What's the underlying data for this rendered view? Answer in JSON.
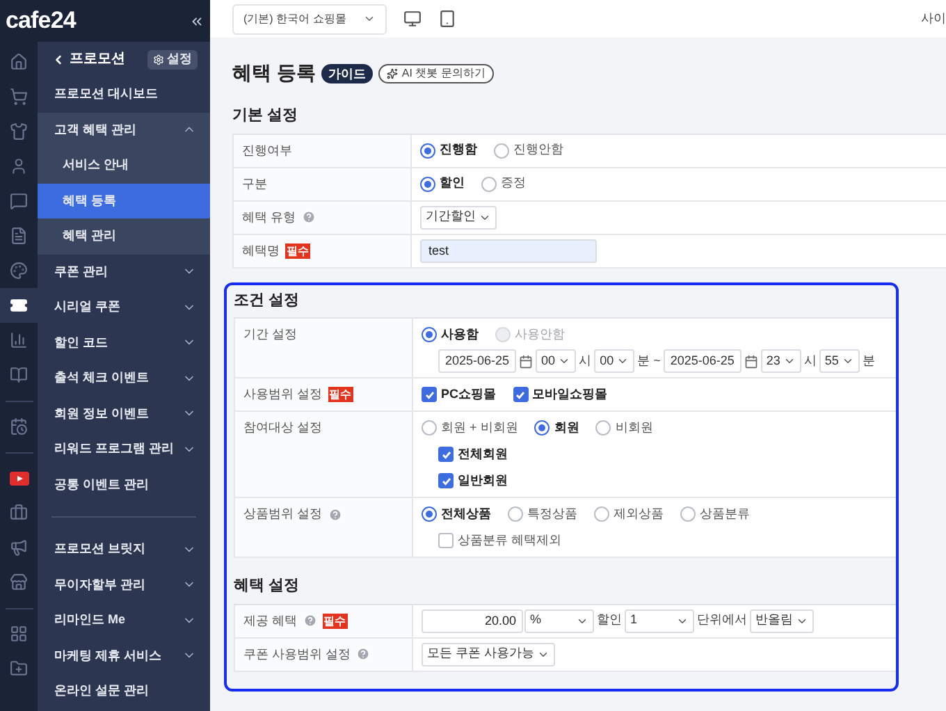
{
  "sidebar": {
    "logo": "cafe24",
    "rail": [
      {
        "kind": "home",
        "selected": false
      },
      {
        "kind": "cart",
        "selected": false
      },
      {
        "kind": "shirt",
        "selected": false
      },
      {
        "kind": "user",
        "selected": false
      },
      {
        "kind": "chat",
        "selected": false
      },
      {
        "kind": "document",
        "selected": false
      },
      {
        "kind": "palette",
        "selected": false
      },
      {
        "kind": "ticket",
        "selected": true
      },
      {
        "kind": "chart",
        "selected": false
      },
      {
        "kind": "book",
        "selected": false
      },
      {
        "kind": "divider"
      },
      {
        "kind": "calendar",
        "selected": false
      },
      {
        "kind": "divider"
      },
      {
        "kind": "video",
        "selected": false
      },
      {
        "kind": "bag",
        "selected": false
      },
      {
        "kind": "megaphone",
        "selected": false
      },
      {
        "kind": "store",
        "selected": false
      },
      {
        "kind": "divider"
      },
      {
        "kind": "apps",
        "selected": false
      },
      {
        "kind": "folder",
        "selected": false
      }
    ],
    "menu_title": "프로모션",
    "settings": "설정",
    "menu_sections": [
      [
        {
          "kind": "link",
          "label": "프로모션 대시보드",
          "selected": false
        },
        {
          "kind": "group",
          "label": "고객 혜택 관리",
          "expanded": true,
          "selected": false,
          "children": [
            {
              "label": "서비스 안내",
              "selected": false
            },
            {
              "label": "혜택 등록",
              "selected": true
            },
            {
              "label": "혜택 관리",
              "selected": false
            }
          ]
        },
        {
          "kind": "group",
          "label": "쿠폰 관리",
          "expanded": false,
          "selected": false
        },
        {
          "kind": "group",
          "label": "시리얼 쿠폰",
          "expanded": false,
          "selected": false
        },
        {
          "kind": "group",
          "label": "할인 코드",
          "expanded": false,
          "selected": false
        },
        {
          "kind": "group",
          "label": "출석 체크 이벤트",
          "expanded": false,
          "selected": false
        },
        {
          "kind": "group",
          "label": "회원 정보 이벤트",
          "expanded": false,
          "selected": false
        },
        {
          "kind": "group",
          "label": "리워드 프로그램 관리",
          "expanded": false,
          "selected": false
        },
        {
          "kind": "link",
          "label": "공통 이벤트 관리",
          "selected": false
        }
      ],
      [
        {
          "kind": "group",
          "label": "프로모션 브릿지",
          "expanded": false,
          "selected": false
        },
        {
          "kind": "group",
          "label": "무이자할부 관리",
          "expanded": false,
          "selected": false
        },
        {
          "kind": "group",
          "label": "리마인드 Me",
          "expanded": false,
          "selected": false
        },
        {
          "kind": "group",
          "label": "마케팅 제휴 서비스",
          "expanded": false,
          "selected": false
        },
        {
          "kind": "link",
          "label": "온라인 설문 관리",
          "selected": false
        }
      ]
    ]
  },
  "topbar": {
    "shop_select": "(기본) 한국어 쇼핑몰",
    "right_text": "사이"
  },
  "page": {
    "title": "혜택 등록",
    "guide": "가이드",
    "ai_button": "AI 챗봇 문의하기"
  },
  "sections": [
    {
      "title": "기본 설정",
      "highlighted": false,
      "rows": [
        {
          "label": "진행여부",
          "help": false,
          "lines": [
            [
              {
                "kind": "radio",
                "label": "진행함",
                "selected": true,
                "disabled": false
              },
              {
                "kind": "radio",
                "label": "진행안함",
                "selected": false,
                "disabled": false
              }
            ]
          ]
        },
        {
          "label": "구분",
          "help": false,
          "lines": [
            [
              {
                "kind": "radio",
                "label": "할인",
                "selected": true,
                "disabled": false
              },
              {
                "kind": "radio",
                "label": "증정",
                "selected": false,
                "disabled": false
              }
            ]
          ]
        },
        {
          "label": "혜택 유형",
          "help": true,
          "lines": [
            [
              {
                "kind": "select",
                "value": "기간할인"
              }
            ]
          ]
        },
        {
          "label": "혜택명",
          "help": false,
          "required": "필수",
          "lines": [
            [
              {
                "kind": "input",
                "value": "test"
              }
            ]
          ]
        }
      ]
    },
    {
      "title": "조건 설정",
      "highlighted": true,
      "rows": [
        {
          "label": "기간 설정",
          "help": false,
          "lines": [
            [
              {
                "kind": "radio",
                "label": "사용함",
                "selected": true,
                "disabled": false
              },
              {
                "kind": "radio",
                "label": "사용안함",
                "selected": false,
                "disabled": true
              }
            ],
            [
              {
                "kind": "date",
                "value": "2025-06-25"
              },
              {
                "kind": "select",
                "value": "00"
              },
              {
                "kind": "text",
                "text": "시"
              },
              {
                "kind": "select",
                "value": "00"
              },
              {
                "kind": "text",
                "text": "분 ~"
              },
              {
                "kind": "date",
                "value": "2025-06-25"
              },
              {
                "kind": "select",
                "value": "23"
              },
              {
                "kind": "text",
                "text": "시"
              },
              {
                "kind": "select",
                "value": "55"
              },
              {
                "kind": "text",
                "text": "분"
              }
            ]
          ]
        },
        {
          "label": "사용범위 설정",
          "help": false,
          "required": "필수",
          "lines": [
            [
              {
                "kind": "checkbox",
                "label": "PC쇼핑몰",
                "checked": true
              },
              {
                "kind": "checkbox",
                "label": "모바일쇼핑몰",
                "checked": true
              }
            ]
          ]
        },
        {
          "label": "참여대상 설정",
          "help": false,
          "lines": [
            [
              {
                "kind": "radio",
                "label": "회원 + 비회원",
                "selected": false,
                "disabled": false
              },
              {
                "kind": "radio",
                "label": "회원",
                "selected": true,
                "disabled": false
              },
              {
                "kind": "radio",
                "label": "비회원",
                "selected": false,
                "disabled": false
              }
            ],
            [
              {
                "kind": "checkbox",
                "label": "전체회원",
                "checked": true
              }
            ],
            [
              {
                "kind": "checkbox",
                "label": "일반회원",
                "checked": true
              }
            ]
          ]
        },
        {
          "label": "상품범위 설정",
          "help": true,
          "lines": [
            [
              {
                "kind": "radio",
                "label": "전체상품",
                "selected": true,
                "disabled": false
              },
              {
                "kind": "radio",
                "label": "특정상품",
                "selected": false,
                "disabled": false
              },
              {
                "kind": "radio",
                "label": "제외상품",
                "selected": false,
                "disabled": false
              },
              {
                "kind": "radio",
                "label": "상품분류",
                "selected": false,
                "disabled": false
              }
            ],
            [
              {
                "kind": "checkbox",
                "label": "상품분류 혜택제외",
                "checked": false
              }
            ]
          ]
        }
      ]
    },
    {
      "title": "혜택 설정",
      "highlighted": true,
      "rows": [
        {
          "label": "제공 혜택",
          "help": true,
          "required": "필수",
          "lines": [
            [
              {
                "kind": "number",
                "value": "20.00"
              },
              {
                "kind": "select",
                "value": "%",
                "wide": true
              },
              {
                "kind": "text",
                "text": "할인"
              },
              {
                "kind": "select",
                "value": "1",
                "wide": true
              },
              {
                "kind": "text",
                "text": "단위에서"
              },
              {
                "kind": "select",
                "value": "반올림"
              }
            ]
          ]
        },
        {
          "label": "쿠폰 사용범위 설정",
          "help": true,
          "lines": [
            [
              {
                "kind": "select",
                "value": "모든 쿠폰 사용가능"
              }
            ]
          ]
        }
      ]
    }
  ]
}
